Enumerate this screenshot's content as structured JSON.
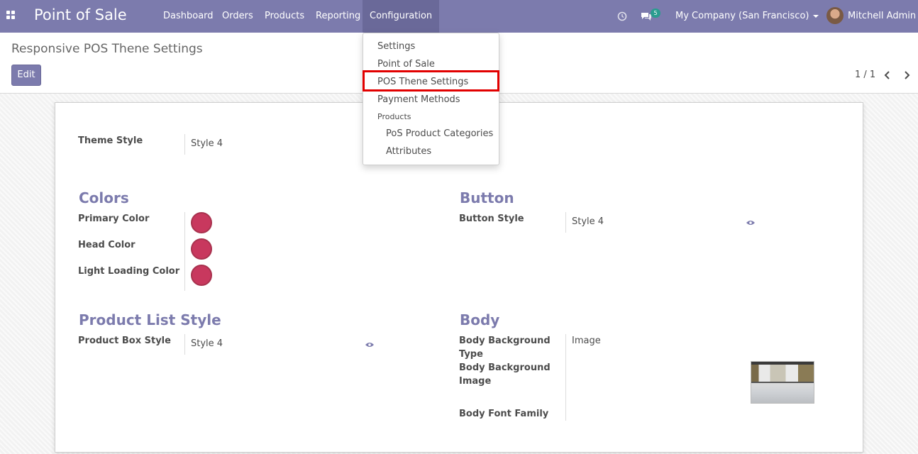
{
  "navbar": {
    "brand": "Point of Sale",
    "menus": [
      "Dashboard",
      "Orders",
      "Products",
      "Reporting",
      "Configuration"
    ],
    "active_menu": "Configuration",
    "messages_count": "5",
    "company": "My Company (San Francisco)",
    "user": "Mitchell Admin"
  },
  "control_panel": {
    "title": "Responsive POS Thene Settings",
    "edit_label": "Edit",
    "pager": "1 / 1"
  },
  "dropdown": {
    "items": [
      "Settings",
      "Point of Sale",
      "POS Thene Settings",
      "Payment Methods"
    ],
    "products_header": "Products",
    "product_items": [
      "PoS Product Categories",
      "Attributes"
    ]
  },
  "form": {
    "theme_style_label": "Theme Style",
    "theme_style_value": "Style 4",
    "colors_title": "Colors",
    "primary_color_label": "Primary Color",
    "head_color_label": "Head Color",
    "light_loading_color_label": "Light Loading Color",
    "primary_color": "#c8385e",
    "head_color": "#c8385e",
    "light_loading_color": "#c8385e",
    "button_title": "Button",
    "button_style_label": "Button Style",
    "button_style_value": "Style 4",
    "product_list_title": "Product List Style",
    "product_box_style_label": "Product Box Style",
    "product_box_style_value": "Style 4",
    "body_title": "Body",
    "body_bg_type_label": "Body Background Type",
    "body_bg_type_value": "Image",
    "body_bg_image_label": "Body Background Image",
    "body_font_family_label": "Body Font Family"
  },
  "colors": {
    "brand": "#7c7bad",
    "active_menu_bg": "#6a6999",
    "highlight": "#e20000",
    "badge": "#2a9d8f"
  }
}
